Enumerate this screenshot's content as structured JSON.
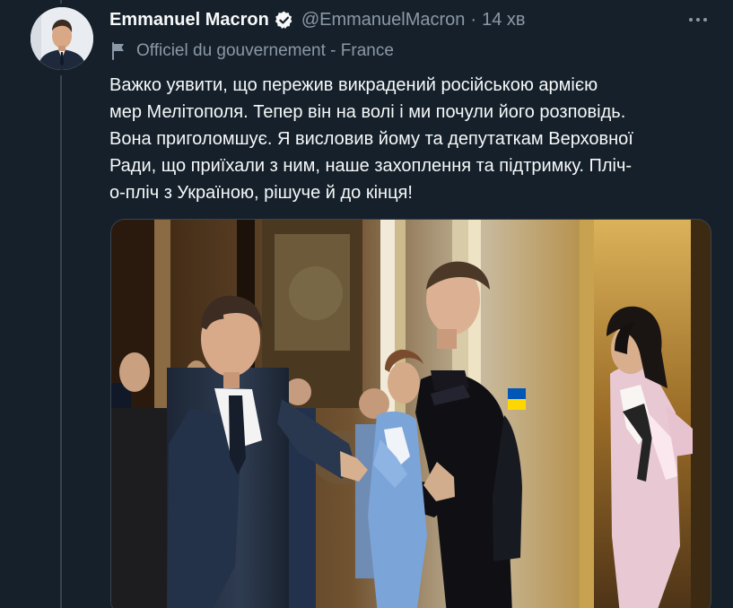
{
  "tweet": {
    "author_name": "Emmanuel Macron",
    "handle": "@EmmanuelMacron",
    "separator": "·",
    "time": "14 хв",
    "label": "Officiel du gouvernement - France",
    "text": "Важко уявити, що пережив викрадений російською армією\nмер Мелітополя. Тепер він на волі і ми почули його розповідь.\nВона приголомшує. Я висловив йому та депутаткам Верховної\nРади, що приїхали з ним, наше захоплення та підтримку. Пліч-\nо-пліч з Україною, рішуче й до кінця!"
  },
  "icons": {
    "verified": "verified-badge-icon",
    "label": "flag-icon",
    "menu": "more-icon"
  },
  "colors": {
    "background": "#15202b",
    "primary_text": "#f7f9f9",
    "secondary_text": "#8b98a5",
    "thread_line": "#38444d"
  }
}
